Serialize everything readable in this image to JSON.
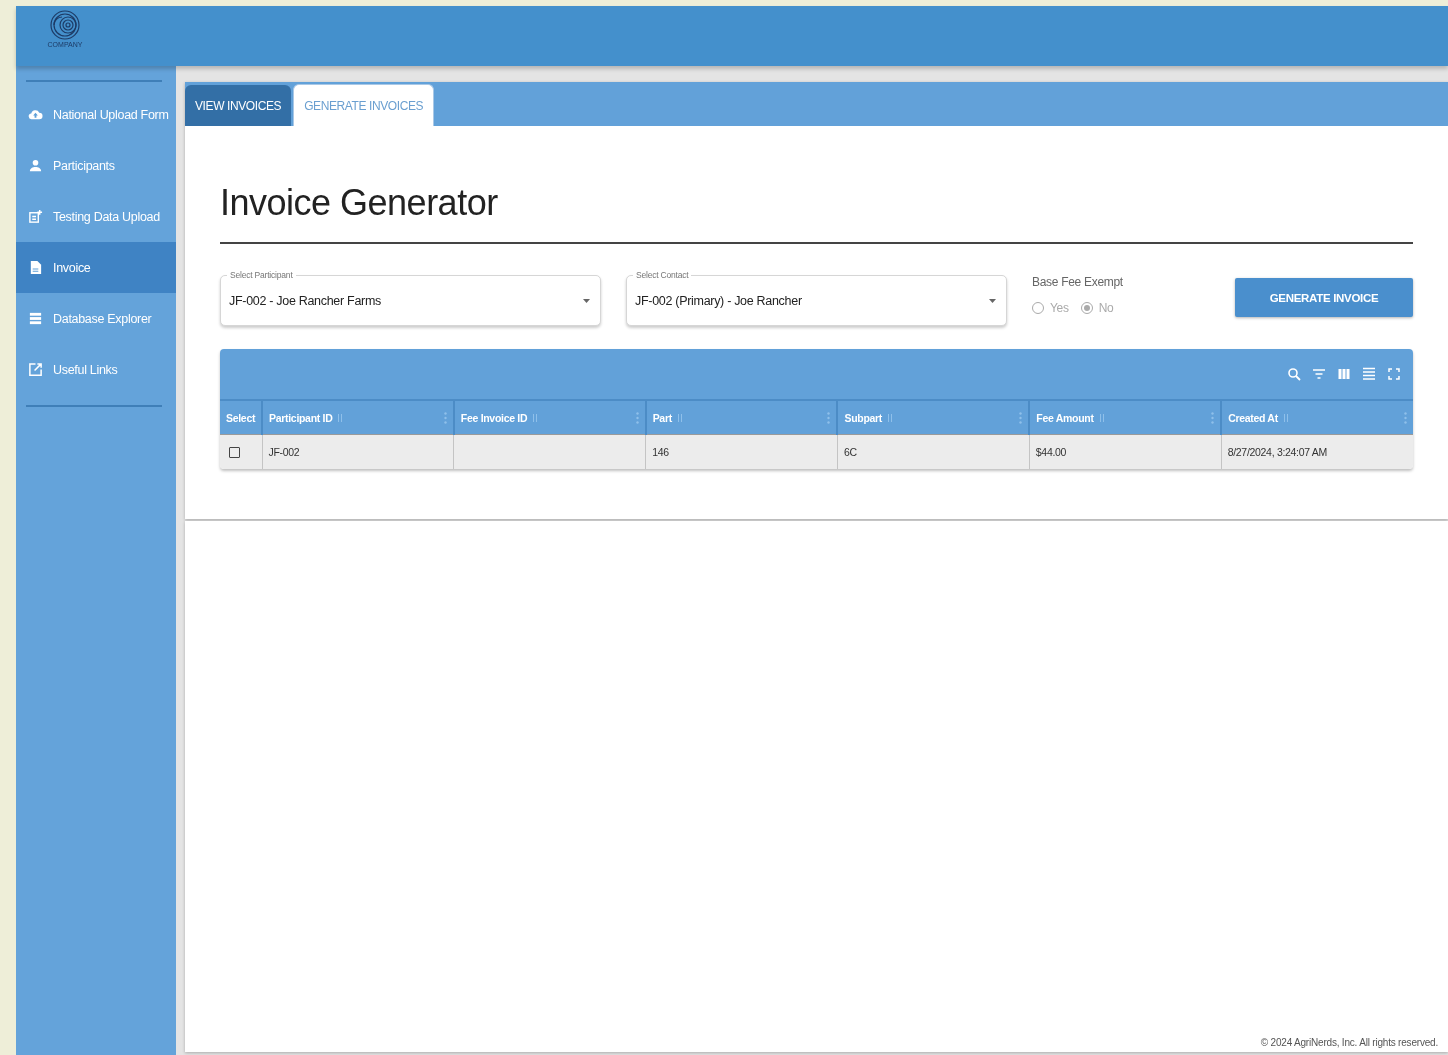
{
  "header": {
    "logo_text": "COMPANY"
  },
  "sidebar": {
    "items": [
      {
        "label": "National Upload Form",
        "selected": false
      },
      {
        "label": "Participants",
        "selected": false
      },
      {
        "label": "Testing Data Upload",
        "selected": false
      },
      {
        "label": "Invoice",
        "selected": true
      },
      {
        "label": "Database Explorer",
        "selected": false
      },
      {
        "label": "Useful Links",
        "selected": false
      }
    ]
  },
  "tabs": [
    {
      "label": "VIEW INVOICES",
      "selected": false
    },
    {
      "label": "GENERATE INVOICES",
      "selected": true
    }
  ],
  "title": "Invoice Generator",
  "form": {
    "participant": {
      "label": "Select Participant",
      "value": "JF-002 - Joe Rancher Farms"
    },
    "contact": {
      "label": "Select Contact",
      "value": "JF-002 (Primary) - Joe Rancher"
    },
    "base_fee_exempt": {
      "label": "Base Fee Exempt",
      "disabled": true,
      "options": [
        {
          "label": "Yes",
          "selected": false
        },
        {
          "label": "No",
          "selected": true
        }
      ]
    },
    "button": "GENERATE INVOICE"
  },
  "table": {
    "columns": [
      {
        "label": "Select",
        "kind": "checkbox"
      },
      {
        "label": "Participant ID",
        "kind": "data"
      },
      {
        "label": "Fee Invoice ID",
        "kind": "data"
      },
      {
        "label": "Part",
        "kind": "data"
      },
      {
        "label": "Subpart",
        "kind": "data"
      },
      {
        "label": "Fee Amount",
        "kind": "data"
      },
      {
        "label": "Created At",
        "kind": "data"
      }
    ],
    "rows": [
      {
        "checked": false,
        "cells": [
          "",
          "JF-002",
          "",
          "146",
          "6C",
          "$44.00",
          "8/27/2024, 3:24:07 AM"
        ]
      }
    ]
  },
  "footer": "© 2024 AgriNerds, Inc. All rights reserved."
}
